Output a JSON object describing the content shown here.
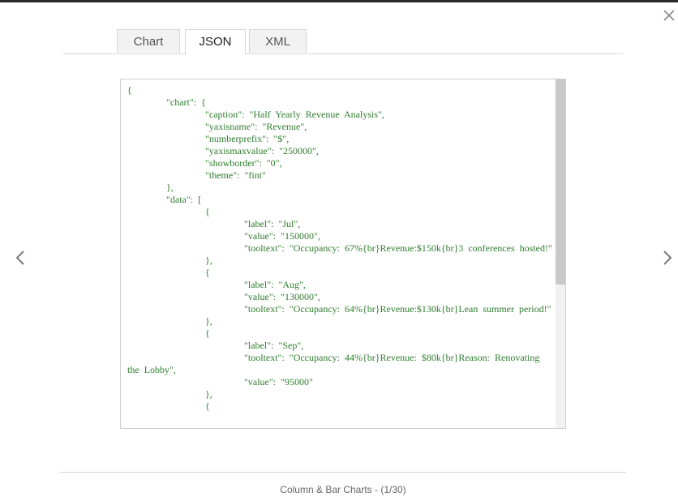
{
  "tabs": {
    "chart": "Chart",
    "json": "JSON",
    "xml": "XML",
    "active": "JSON"
  },
  "code": {
    "text": "{\n        \"chart\": {\n                \"caption\": \"Half Yearly Revenue Analysis\",\n                \"yaxisname\": \"Revenue\",\n                \"numberprefix\": \"$\",\n                \"yaxismaxvalue\": \"250000\",\n                \"showborder\": \"0\",\n                \"theme\": \"fint\"\n        },\n        \"data\": [\n                {\n                        \"label\": \"Jul\",\n                        \"value\": \"150000\",\n                        \"tooltext\": \"Occupancy: 67%{br}Revenue:$150k{br}3 conferences hosted!\"\n                },\n                {\n                        \"label\": \"Aug\",\n                        \"value\": \"130000\",\n                        \"tooltext\": \"Occupancy: 64%{br}Revenue:$130k{br}Lean summer period!\"\n                },\n                {\n                        \"label\": \"Sep\",\n                        \"tooltext\": \"Occupancy: 44%{br}Revenue: $80k{br}Reason: Renovating the Lobby\",\n                        \"value\": \"95000\"\n                },\n                {",
    "text_color": "#2e7d2e"
  },
  "footer": {
    "caption": "Column & Bar Charts - (1/30)"
  },
  "icons": {
    "close": "close-icon",
    "prev": "chevron-left-icon",
    "next": "chevron-right-icon"
  }
}
